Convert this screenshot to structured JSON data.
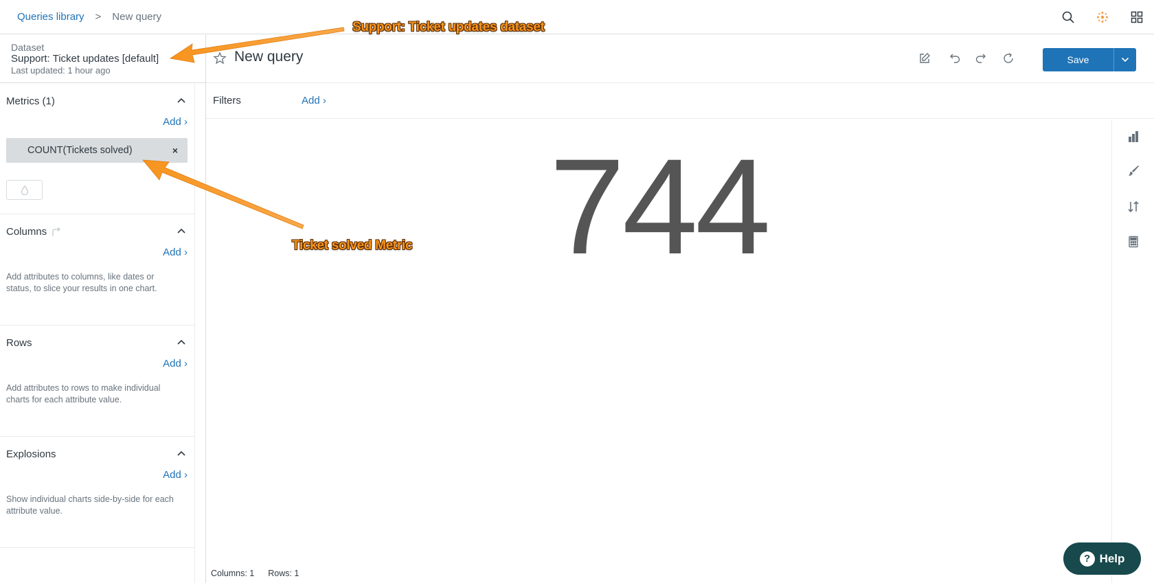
{
  "breadcrumb": {
    "link": "Queries library",
    "separator": ">",
    "current": "New query"
  },
  "top_icons": [
    "search-icon",
    "apps-dot-icon",
    "grid-icon"
  ],
  "dataset": {
    "label": "Dataset",
    "name": "Support: Ticket updates [default]",
    "updated": "Last updated: 1 hour ago"
  },
  "sections": {
    "metrics": {
      "title": "Metrics (1)",
      "add": "Add ›",
      "items": [
        {
          "label": "COUNT(Tickets solved)",
          "remove": "×"
        }
      ]
    },
    "columns": {
      "title": "Columns",
      "add": "Add ›",
      "help": "Add attributes to columns, like dates or status, to slice your results in one chart."
    },
    "rows": {
      "title": "Rows",
      "add": "Add ›",
      "help": "Add attributes to rows to make individual charts for each attribute value."
    },
    "explosions": {
      "title": "Explosions",
      "add": "Add ›",
      "help": "Show individual charts side-by-side for each attribute value."
    }
  },
  "query": {
    "title": "New query",
    "save_label": "Save"
  },
  "filters": {
    "label": "Filters",
    "add": "Add ›"
  },
  "result": {
    "value": "744"
  },
  "footer": {
    "columns": "Columns: 1",
    "rows": "Rows: 1"
  },
  "help": {
    "label": "Help"
  },
  "annotations": {
    "dataset": "Support: Ticket updates dataset",
    "metric": "Ticket solved Metric"
  },
  "colors": {
    "accent": "#1f73b7",
    "help_bg": "#17494d",
    "annotation": "#f7941d",
    "number": "#555555"
  }
}
